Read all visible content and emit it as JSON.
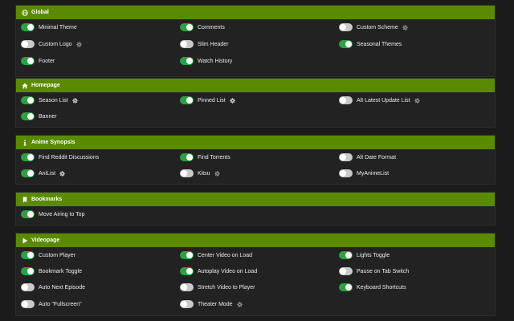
{
  "colors": {
    "accent": "#5a8a00",
    "toggle_on": "#2ea043",
    "toggle_off": "#c9c9c9",
    "background": "#1b1b1b"
  },
  "sections": [
    {
      "title": "Global",
      "icon": "globe-icon",
      "options": [
        {
          "label": "Minimal Theme",
          "on": true,
          "gear": false
        },
        {
          "label": "Comments",
          "on": true,
          "gear": false
        },
        {
          "label": "Custom Scheme",
          "on": false,
          "gear": true
        },
        {
          "label": "Custom Logo",
          "on": false,
          "gear": true
        },
        {
          "label": "Slim Header",
          "on": false,
          "gear": false
        },
        {
          "label": "Seasonal Themes",
          "on": true,
          "gear": false
        },
        {
          "label": "Footer",
          "on": true,
          "gear": false
        },
        {
          "label": "Watch History",
          "on": true,
          "gear": false
        }
      ]
    },
    {
      "title": "Homepage",
      "icon": "home-icon",
      "options": [
        {
          "label": "Season List",
          "on": true,
          "gear": true
        },
        {
          "label": "Pinned List",
          "on": true,
          "gear": true
        },
        {
          "label": "Alt Latest Update List",
          "on": false,
          "gear": true
        },
        {
          "label": "Banner",
          "on": true,
          "gear": false
        }
      ]
    },
    {
      "title": "Anime Synopsis",
      "icon": "info-icon",
      "options": [
        {
          "label": "Find Reddit Discussions",
          "on": true,
          "gear": false
        },
        {
          "label": "Find Torrents",
          "on": true,
          "gear": false
        },
        {
          "label": "Alt Date Format",
          "on": false,
          "gear": false
        },
        {
          "label": "AniList",
          "on": true,
          "gear": true
        },
        {
          "label": "Kitsu",
          "on": false,
          "gear": true
        },
        {
          "label": "MyAnimeList",
          "on": false,
          "gear": false
        }
      ]
    },
    {
      "title": "Bookmarks",
      "icon": "bookmark-icon",
      "options": [
        {
          "label": "Move Airing to Top",
          "on": true,
          "gear": false
        }
      ]
    },
    {
      "title": "Videopage",
      "icon": "play-icon",
      "options": [
        {
          "label": "Custom Player",
          "on": true,
          "gear": false
        },
        {
          "label": "Center Video on Load",
          "on": true,
          "gear": false
        },
        {
          "label": "Lights Toggle",
          "on": true,
          "gear": false
        },
        {
          "label": "Bookmark Toggle",
          "on": true,
          "gear": false
        },
        {
          "label": "Autoplay Video on Load",
          "on": true,
          "gear": false
        },
        {
          "label": "Pause on Tab Switch",
          "on": false,
          "gear": false
        },
        {
          "label": "Auto Next Episode",
          "on": false,
          "gear": false
        },
        {
          "label": "Stretch Video to Player",
          "on": false,
          "gear": false
        },
        {
          "label": "Keyboard Shortcuts",
          "on": true,
          "gear": false
        },
        {
          "label": "Auto \"Fullscreen\"",
          "on": false,
          "gear": false
        },
        {
          "label": "Theater Mode",
          "on": false,
          "gear": true
        }
      ]
    }
  ]
}
